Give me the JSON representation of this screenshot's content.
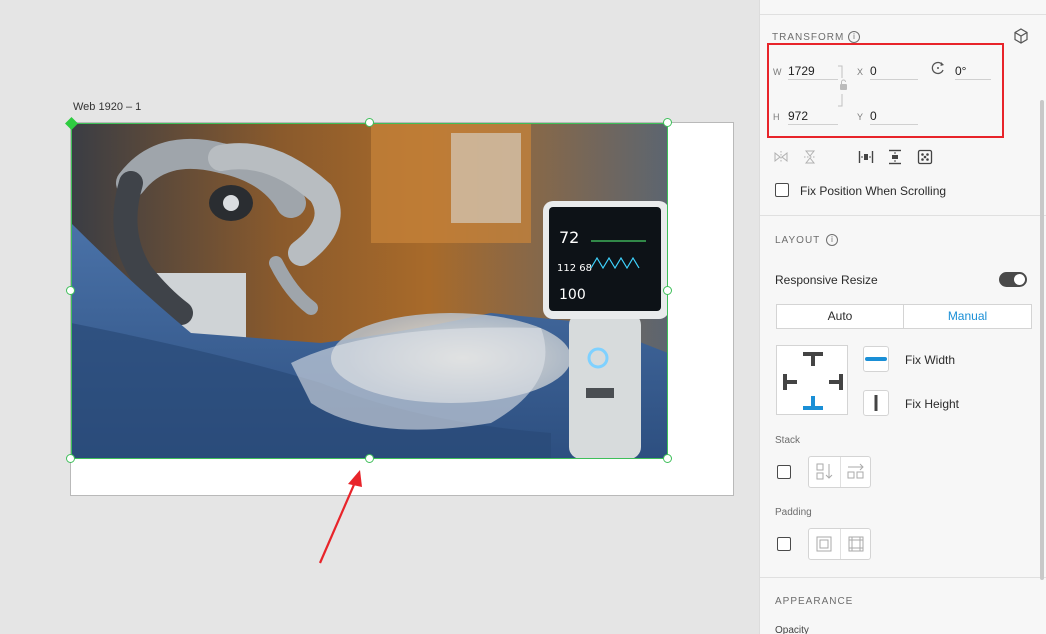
{
  "canvas": {
    "artboard_label": "Web 1920 – 1"
  },
  "transform": {
    "title": "TRANSFORM",
    "w_label": "W",
    "w_value": "1729",
    "h_label": "H",
    "h_value": "972",
    "x_label": "X",
    "x_value": "0",
    "y_label": "Y",
    "y_value": "0",
    "rotation_value": "0°",
    "fix_position_label": "Fix Position When Scrolling"
  },
  "layout": {
    "title": "LAYOUT",
    "responsive_resize_label": "Responsive Resize",
    "responsive_resize_on": true,
    "mode_auto": "Auto",
    "mode_manual": "Manual",
    "active_mode": "Manual",
    "fix_width_label": "Fix Width",
    "fix_height_label": "Fix Height",
    "stack_label": "Stack",
    "padding_label": "Padding"
  },
  "appearance": {
    "title": "APPEARANCE",
    "opacity_label": "Opacity"
  },
  "colors": {
    "selection": "#3fbf5a",
    "accent": "#1a8fd6",
    "annotation": "#e8242a"
  },
  "icons": [
    "cube-icon",
    "info-icon",
    "lock-icon",
    "rotate-icon",
    "flip-horizontal-icon",
    "flip-vertical-icon",
    "distribute-horizontal-icon",
    "distribute-vertical-icon",
    "align-center-icon"
  ]
}
